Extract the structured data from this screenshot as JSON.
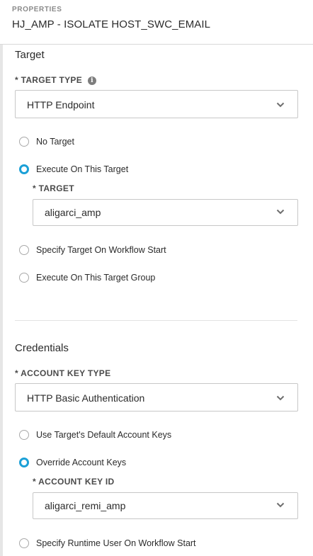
{
  "header": {
    "eyebrow": "PROPERTIES",
    "title": "HJ_AMP - ISOLATE HOST_SWC_EMAIL"
  },
  "target": {
    "section_title": "Target",
    "type_label": "* TARGET TYPE",
    "info_icon": "i",
    "type_value": "HTTP Endpoint",
    "options": [
      {
        "label": "No Target",
        "checked": false
      },
      {
        "label": "Execute On This Target",
        "checked": true
      },
      {
        "label": "Specify Target On Workflow Start",
        "checked": false
      },
      {
        "label": "Execute On This Target Group",
        "checked": false
      }
    ],
    "sub_label": "* TARGET",
    "sub_value": "aligarci_amp"
  },
  "credentials": {
    "section_title": "Credentials",
    "type_label": "* ACCOUNT KEY TYPE",
    "type_value": "HTTP Basic Authentication",
    "options": [
      {
        "label": "Use Target's Default Account Keys",
        "checked": false
      },
      {
        "label": "Override Account Keys",
        "checked": true
      },
      {
        "label": "Specify Runtime User On Workflow Start",
        "checked": false
      }
    ],
    "sub_label": "* ACCOUNT KEY ID",
    "sub_value": "aligarci_remi_amp"
  },
  "colors": {
    "accent": "#1ba0d7",
    "border": "#c7c7c7",
    "muted": "#8a8a8a"
  }
}
